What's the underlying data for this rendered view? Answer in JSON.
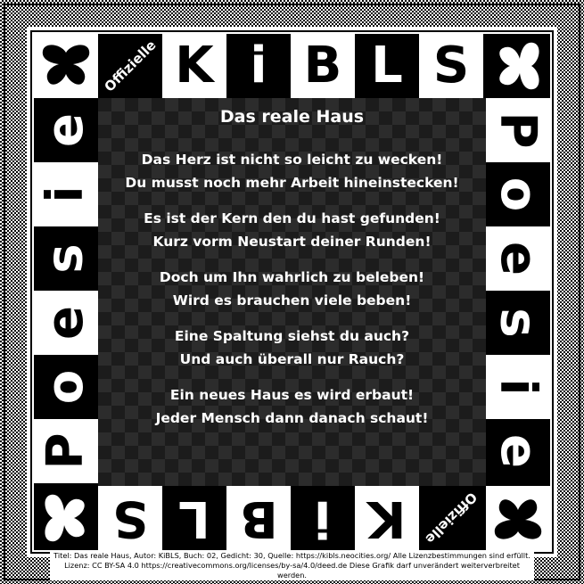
{
  "header": {
    "badge": "Offizielle",
    "letters": [
      "K",
      "i",
      "B",
      "L",
      "S"
    ]
  },
  "side_word": [
    "P",
    "o",
    "e",
    "s",
    "i",
    "e"
  ],
  "footer_badge": "Offizielle",
  "bottom_letters": [
    "S",
    "L",
    "B",
    "i",
    "K"
  ],
  "poem": {
    "title": "Das reale Haus",
    "stanzas": [
      [
        "Das Herz ist nicht so leicht zu wecken!",
        "Du musst noch mehr Arbeit hineinstecken!"
      ],
      [
        "Es ist der Kern den du hast gefunden!",
        "Kurz vorm Neustart deiner Runden!"
      ],
      [
        "Doch um Ihn wahrlich zu beleben!",
        "Wird es brauchen viele beben!"
      ],
      [
        "Eine Spaltung siehst du auch?",
        "Und auch überall nur Rauch?"
      ],
      [
        "Ein neues Haus es wird erbaut!",
        "Jeder Mensch dann danach schaut!"
      ]
    ]
  },
  "footer": {
    "line1": "Titel: Das reale Haus, Autor: KiBLS, Buch: 02, Gedicht: 30, Quelle: https://kibls.neocities.org/ Alle Lizenzbestimmungen sind erfüllt.",
    "line2": "Lizenz: CC BY-SA 4.0 https://creativecommons.org/licenses/by-sa/4.0/deed.de Diese Grafik darf unverändert weiterverbreitet werden."
  },
  "icons": [
    "butterfly-icon"
  ]
}
